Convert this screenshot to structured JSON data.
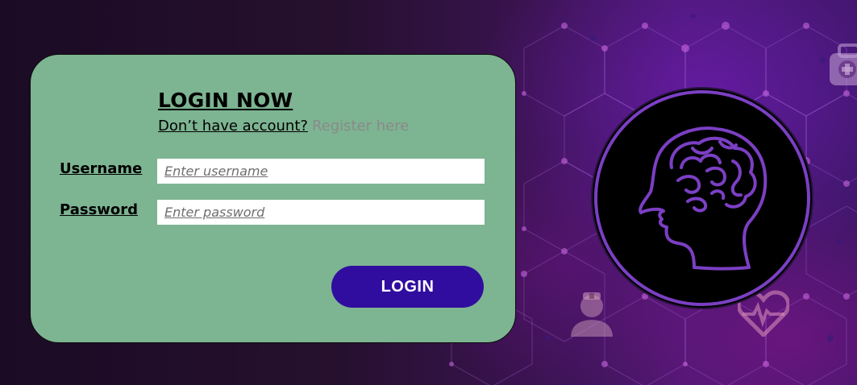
{
  "login": {
    "heading": "LOGIN NOW",
    "no_account_text": "Don’t have account?",
    "register_link": "Register here",
    "username_label": "Username",
    "username_placeholder": "Enter username",
    "password_label": "Password",
    "password_placeholder": "Enter password",
    "login_button": "LOGIN"
  },
  "logo": {
    "icon": "brain-head-icon",
    "accent_color": "#7b3fc4"
  },
  "background": {
    "icons": [
      "medical-kit-icon",
      "doctor-icon",
      "heart-pulse-icon"
    ]
  },
  "colors": {
    "card": "#7db492",
    "button": "#300d9f",
    "link": "#8a8a8a"
  }
}
